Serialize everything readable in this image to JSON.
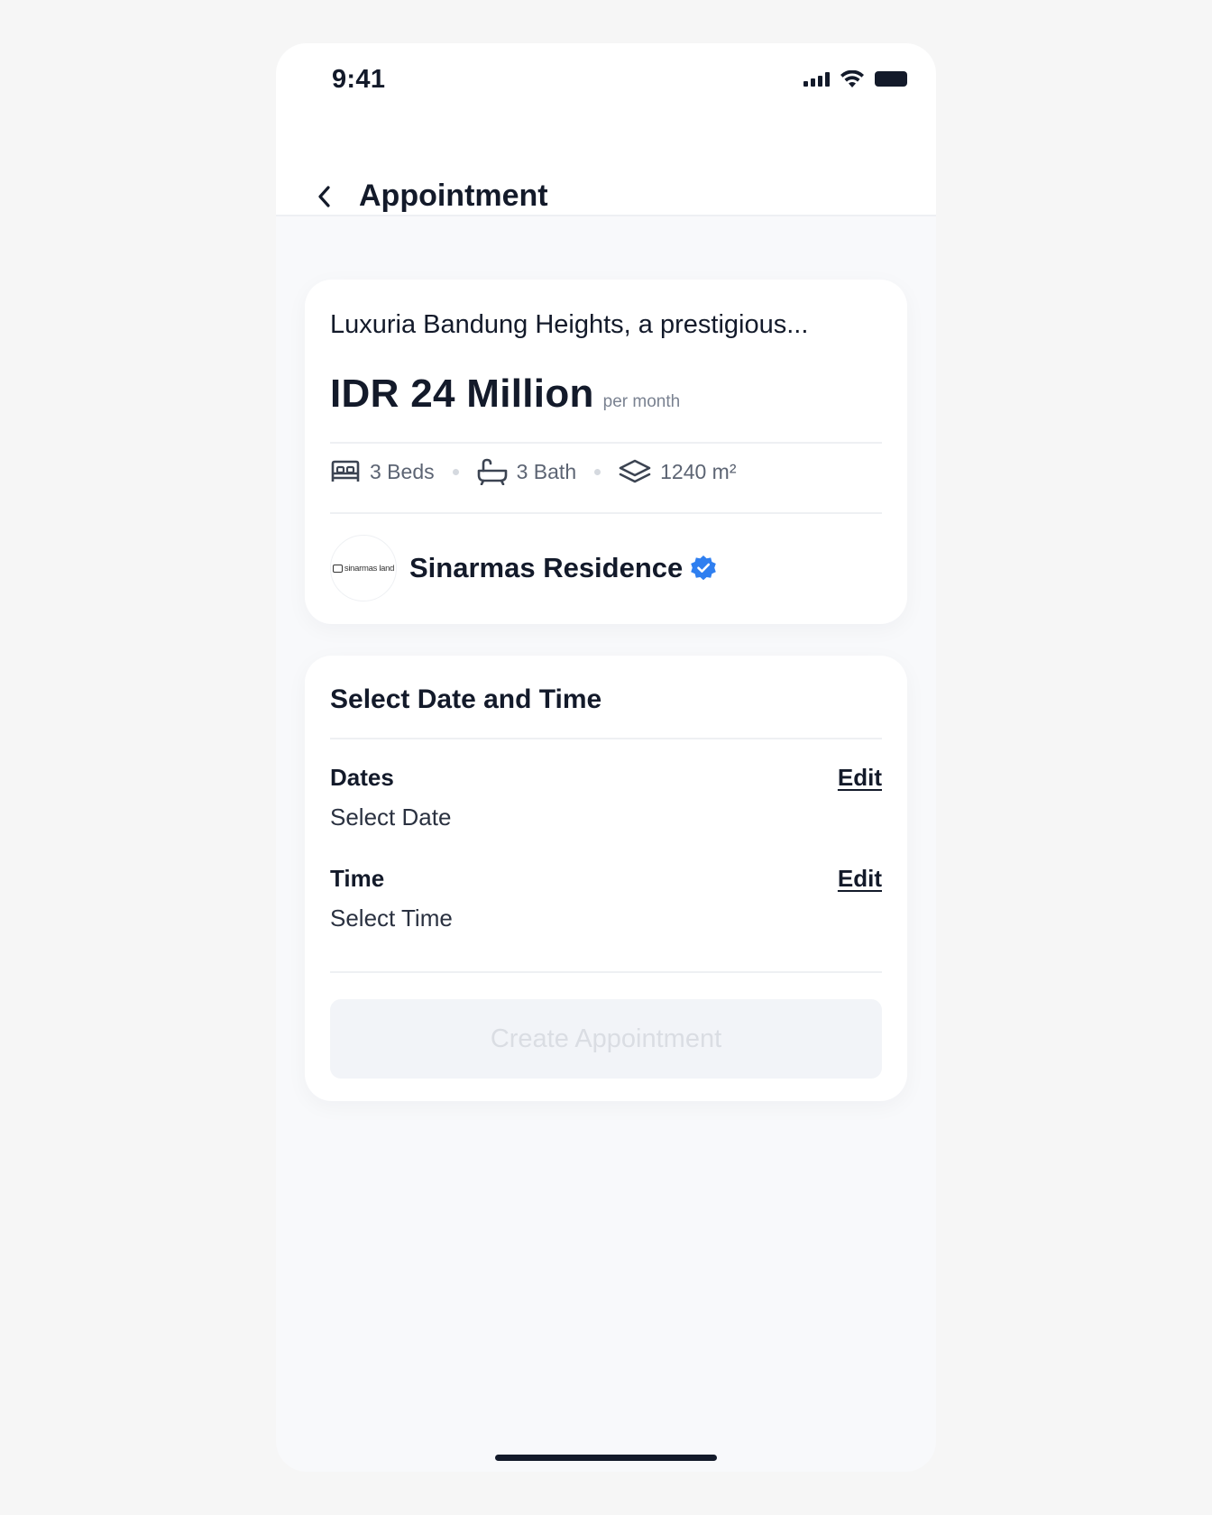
{
  "status_bar": {
    "time": "9:41"
  },
  "header": {
    "title": "Appointment"
  },
  "property": {
    "title": "Luxuria Bandung Heights, a prestigious...",
    "price": "IDR 24 Million",
    "price_period": "per month",
    "specs": {
      "beds": "3 Beds",
      "bath": "3 Bath",
      "area": "1240 m²"
    },
    "developer": {
      "logo_text": "sinarmas land",
      "name": "Sinarmas Residence"
    }
  },
  "schedule": {
    "section_title": "Select Date and Time",
    "dates": {
      "label": "Dates",
      "value": "Select Date",
      "edit_label": "Edit"
    },
    "time": {
      "label": "Time",
      "value": "Select Time",
      "edit_label": "Edit"
    },
    "submit_label": "Create Appointment"
  },
  "colors": {
    "verified": "#2f7ff0",
    "text": "#131a2a",
    "disabled_button": "#f2f4f8"
  }
}
